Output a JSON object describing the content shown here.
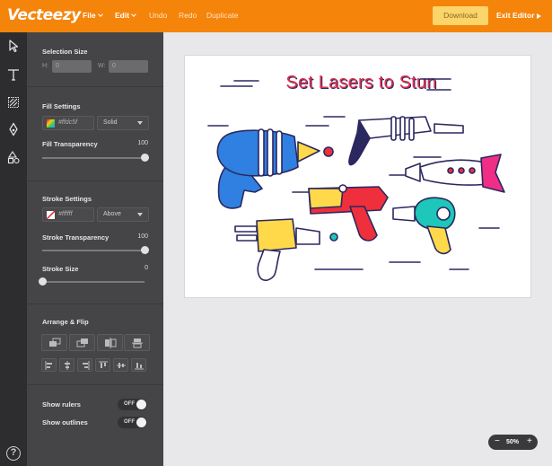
{
  "app": {
    "brand": "Vecteezy"
  },
  "topbar": {
    "file": "File",
    "edit": "Edit",
    "undo": "Undo",
    "redo": "Redo",
    "duplicate": "Duplicate",
    "download": "Download",
    "exit": "Exit Editor"
  },
  "tools": [
    "cursor-icon",
    "text-icon",
    "pattern-icon",
    "pen-icon",
    "shapes-icon"
  ],
  "panel": {
    "selection_size": "Selection Size",
    "h_label": "H:",
    "h_value": "0",
    "w_label": "W:",
    "w_value": "0",
    "fill_settings": "Fill Settings",
    "fill_hex": "#ffdc5f",
    "fill_type": "Solid",
    "fill_transparency": "Fill Transparency",
    "fill_transparency_value": "100",
    "stroke_settings": "Stroke Settings",
    "stroke_hex": "#ffffff",
    "stroke_position": "Above",
    "stroke_transparency": "Stroke Transparency",
    "stroke_transparency_value": "100",
    "stroke_size": "Stroke Size",
    "stroke_size_value": "0",
    "arrange_flip": "Arrange & Flip",
    "show_rulers": "Show rulers",
    "show_rulers_state": "OFF",
    "show_outlines": "Show outlines",
    "show_outlines_state": "OFF"
  },
  "levels": {
    "fill_transparency": 1.0,
    "stroke_transparency": 1.0,
    "stroke_size": 0.0
  },
  "colors": {
    "brand_orange": "#f5840b",
    "download_yellow": "#fbd46a",
    "title_red": "#e0314d",
    "navy": "#2b2860",
    "blue": "#2f80e0",
    "yellow": "#ffd94a",
    "teal": "#1ec7b9",
    "pink": "#f02e86",
    "red": "#ef2f3c"
  },
  "canvas": {
    "title": "Set Lasers to Stun"
  },
  "zoom": {
    "minus": "−",
    "value": "50%",
    "plus": "+"
  }
}
